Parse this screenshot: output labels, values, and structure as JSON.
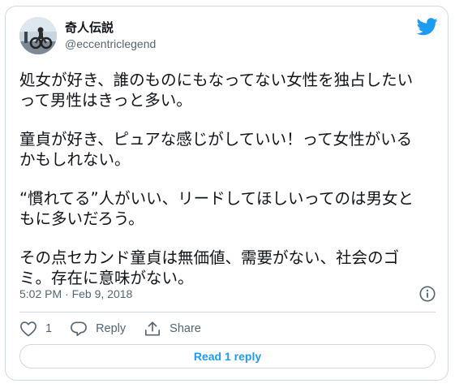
{
  "author": {
    "display_name": "奇人伝説",
    "handle": "@eccentriclegend"
  },
  "tweet": {
    "paragraphs": [
      "処女が好き、誰のものにもなってない女性を独占したい\nって男性はきっと多い。",
      "童貞が好き、ピュアな感じがしていい！って女性がいる\nかもしれない。",
      "“慣れてる”人がいい、リードしてほしいってのは男女と\nもに多いだろう。",
      "その点セカンド童貞は無価値、需要がない、社会のゴ\nミ。存在に意味がない。"
    ],
    "timestamp": "5:02 PM · Feb 9, 2018"
  },
  "actions": {
    "like_count": "1",
    "reply_label": "Reply",
    "share_label": "Share"
  },
  "read_replies_label": "Read 1 reply",
  "colors": {
    "twitter_blue": "#1d9bf0",
    "text": "#0f1419",
    "muted": "#536471",
    "border": "#cfd9de"
  },
  "icons": [
    "twitter-bird-icon",
    "info-icon",
    "heart-icon",
    "reply-icon",
    "share-icon"
  ]
}
